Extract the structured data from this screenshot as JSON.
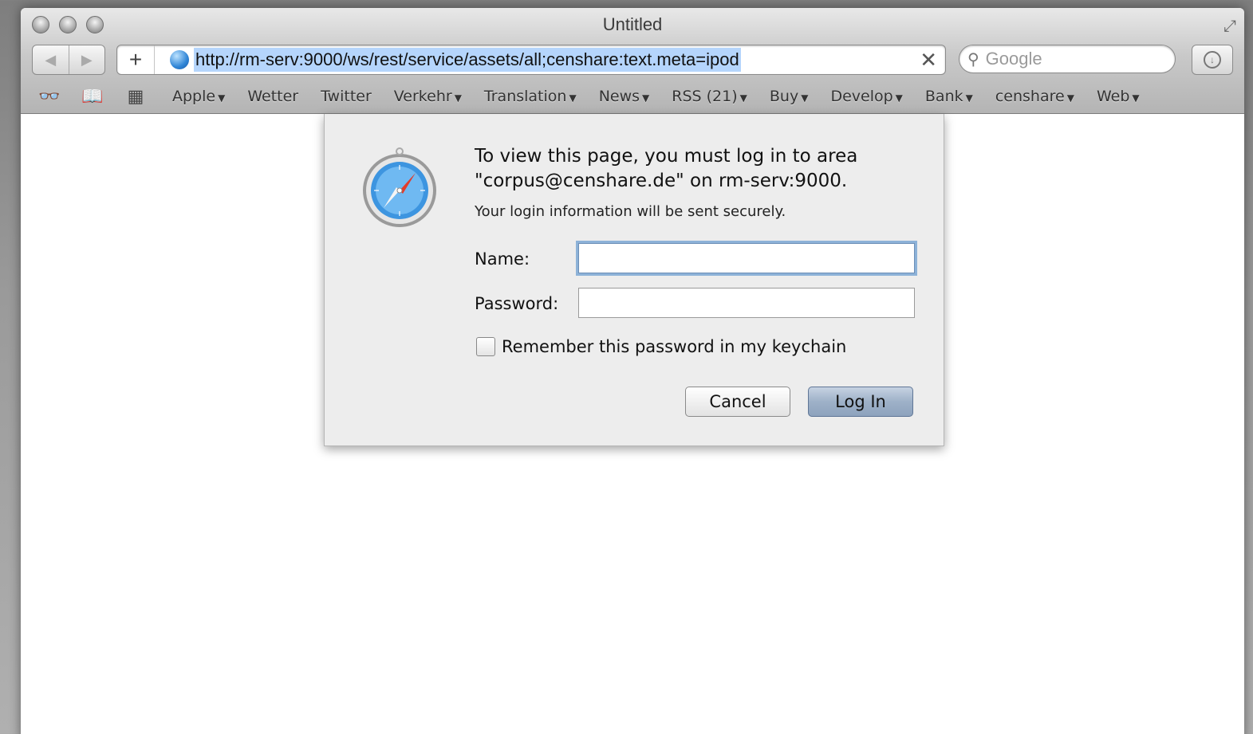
{
  "window": {
    "title": "Untitled"
  },
  "toolbar": {
    "url": "http://rm-serv:9000/ws/rest/service/assets/all;censhare:text.meta=ipod",
    "add_label": "+",
    "clear_label": "✕",
    "search_placeholder": "Google"
  },
  "bookmarks": [
    {
      "label": "Apple",
      "menu": true
    },
    {
      "label": "Wetter",
      "menu": false
    },
    {
      "label": "Twitter",
      "menu": false
    },
    {
      "label": "Verkehr",
      "menu": true
    },
    {
      "label": "Translation",
      "menu": true
    },
    {
      "label": "News",
      "menu": true
    },
    {
      "label": "RSS (21)",
      "menu": true
    },
    {
      "label": "Buy",
      "menu": true
    },
    {
      "label": "Develop",
      "menu": true
    },
    {
      "label": "Bank",
      "menu": true
    },
    {
      "label": "censhare",
      "menu": true
    },
    {
      "label": "Web",
      "menu": true
    }
  ],
  "dialog": {
    "message": "To view this page, you must log in to area \"corpus@censhare.de\" on rm-serv:9000.",
    "secure_note": "Your login information will be sent securely.",
    "name_label": "Name:",
    "name_value": "",
    "password_label": "Password:",
    "password_value": "",
    "remember_label": "Remember this password in my keychain",
    "remember_checked": false,
    "cancel_label": "Cancel",
    "login_label": "Log In"
  },
  "colors": {
    "url_highlight": "#b5d5fc",
    "login_button": "#9eb1c8",
    "focus_ring": "#8db2d8"
  }
}
